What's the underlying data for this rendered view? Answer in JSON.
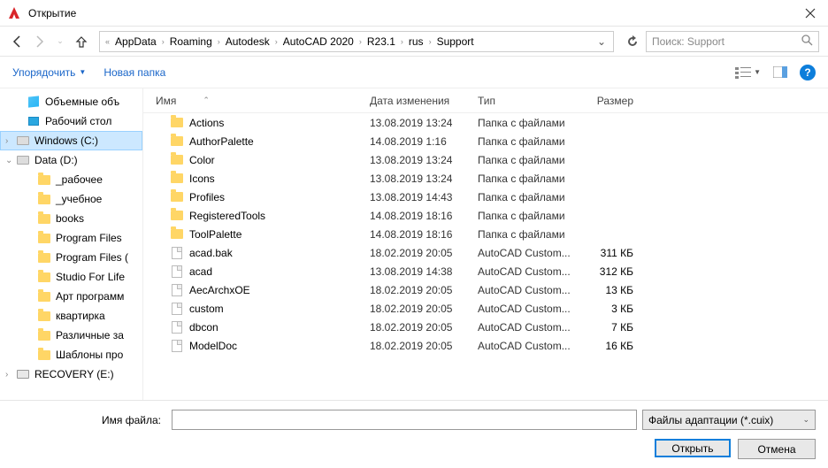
{
  "title": "Открытие",
  "breadcrumb": [
    "AppData",
    "Roaming",
    "Autodesk",
    "AutoCAD 2020",
    "R23.1",
    "rus",
    "Support"
  ],
  "search_placeholder": "Поиск: Support",
  "toolbar": {
    "organize": "Упорядочить",
    "newfolder": "Новая папка"
  },
  "columns": {
    "name": "Имя",
    "date": "Дата изменения",
    "type": "Тип",
    "size": "Размер"
  },
  "tree": [
    {
      "label": "Объемные объ",
      "icon": "obj",
      "chev": "",
      "indent": 18
    },
    {
      "label": "Рабочий стол",
      "icon": "desk",
      "chev": "",
      "indent": 18
    },
    {
      "label": "Windows (C:)",
      "icon": "disk",
      "chev": "›",
      "indent": 6,
      "selected": true
    },
    {
      "label": "Data (D:)",
      "icon": "disk",
      "chev": "⌄",
      "indent": 6
    },
    {
      "label": "_рабочее",
      "icon": "folder",
      "chev": "",
      "indent": 30
    },
    {
      "label": "_учебное",
      "icon": "folder",
      "chev": "",
      "indent": 30
    },
    {
      "label": "books",
      "icon": "folder",
      "chev": "",
      "indent": 30
    },
    {
      "label": "Program Files",
      "icon": "folder",
      "chev": "",
      "indent": 30
    },
    {
      "label": "Program Files (",
      "icon": "folder",
      "chev": "",
      "indent": 30
    },
    {
      "label": "Studio For Life",
      "icon": "folder",
      "chev": "",
      "indent": 30
    },
    {
      "label": "Арт программ",
      "icon": "folder",
      "chev": "",
      "indent": 30
    },
    {
      "label": "квартирка",
      "icon": "folder",
      "chev": "",
      "indent": 30
    },
    {
      "label": "Различные за",
      "icon": "folder",
      "chev": "",
      "indent": 30
    },
    {
      "label": "Шаблоны про",
      "icon": "folder",
      "chev": "",
      "indent": 30
    },
    {
      "label": "RECOVERY (E:)",
      "icon": "drive",
      "chev": "›",
      "indent": 6
    }
  ],
  "files": [
    {
      "name": "Actions",
      "date": "13.08.2019 13:24",
      "type": "Папка с файлами",
      "size": "",
      "icon": "folder"
    },
    {
      "name": "AuthorPalette",
      "date": "14.08.2019 1:16",
      "type": "Папка с файлами",
      "size": "",
      "icon": "folder"
    },
    {
      "name": "Color",
      "date": "13.08.2019 13:24",
      "type": "Папка с файлами",
      "size": "",
      "icon": "folder"
    },
    {
      "name": "Icons",
      "date": "13.08.2019 13:24",
      "type": "Папка с файлами",
      "size": "",
      "icon": "folder"
    },
    {
      "name": "Profiles",
      "date": "13.08.2019 14:43",
      "type": "Папка с файлами",
      "size": "",
      "icon": "folder"
    },
    {
      "name": "RegisteredTools",
      "date": "14.08.2019 18:16",
      "type": "Папка с файлами",
      "size": "",
      "icon": "folder"
    },
    {
      "name": "ToolPalette",
      "date": "14.08.2019 18:16",
      "type": "Папка с файлами",
      "size": "",
      "icon": "folder"
    },
    {
      "name": "acad.bak",
      "date": "18.02.2019 20:05",
      "type": "AutoCAD Custom...",
      "size": "311 КБ",
      "icon": "file"
    },
    {
      "name": "acad",
      "date": "13.08.2019 14:38",
      "type": "AutoCAD Custom...",
      "size": "312 КБ",
      "icon": "file"
    },
    {
      "name": "AecArchxOE",
      "date": "18.02.2019 20:05",
      "type": "AutoCAD Custom...",
      "size": "13 КБ",
      "icon": "file"
    },
    {
      "name": "custom",
      "date": "18.02.2019 20:05",
      "type": "AutoCAD Custom...",
      "size": "3 КБ",
      "icon": "file"
    },
    {
      "name": "dbcon",
      "date": "18.02.2019 20:05",
      "type": "AutoCAD Custom...",
      "size": "7 КБ",
      "icon": "file"
    },
    {
      "name": "ModelDoc",
      "date": "18.02.2019 20:05",
      "type": "AutoCAD Custom...",
      "size": "16 КБ",
      "icon": "file"
    }
  ],
  "footer": {
    "filename_label": "Имя файла:",
    "filetype": "Файлы адаптации (*.cuix)",
    "open": "Открыть",
    "cancel": "Отмена"
  }
}
